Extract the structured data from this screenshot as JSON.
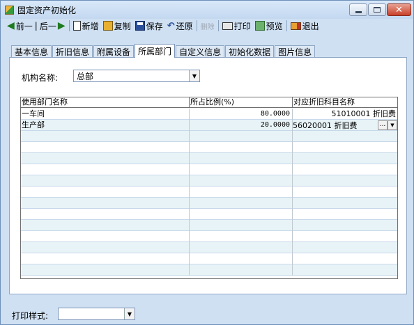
{
  "window": {
    "title": "固定资产初始化",
    "close_symbol": "✕"
  },
  "toolbar": {
    "prev": "前一",
    "next": "后一",
    "new": "新增",
    "copy": "复制",
    "save": "保存",
    "restore": "还原",
    "delete": "删除",
    "print": "打印",
    "preview": "预览",
    "exit": "退出"
  },
  "tabs": [
    {
      "label": "基本信息"
    },
    {
      "label": "折旧信息"
    },
    {
      "label": "附属设备"
    },
    {
      "label": "所属部门"
    },
    {
      "label": "自定义信息"
    },
    {
      "label": "初始化数据"
    },
    {
      "label": "图片信息"
    }
  ],
  "active_tab": "所属部门",
  "org": {
    "label": "机构名称:",
    "value": "总部"
  },
  "grid": {
    "headers": [
      "使用部门名称",
      "所占比例(%)",
      "对应折旧科目名称"
    ],
    "rows": [
      {
        "dept": "一车间",
        "ratio": "80.0000",
        "account": "51010001 折旧费"
      },
      {
        "dept": "生产部",
        "ratio": "20.0000",
        "account": "56020001 折旧费"
      }
    ],
    "editor_button": "..."
  },
  "footer": {
    "print_style_label": "打印样式:",
    "print_style_value": ""
  },
  "colors": {
    "window_bg": "#cfe0f3",
    "row_alt": "#e8f3f7"
  }
}
